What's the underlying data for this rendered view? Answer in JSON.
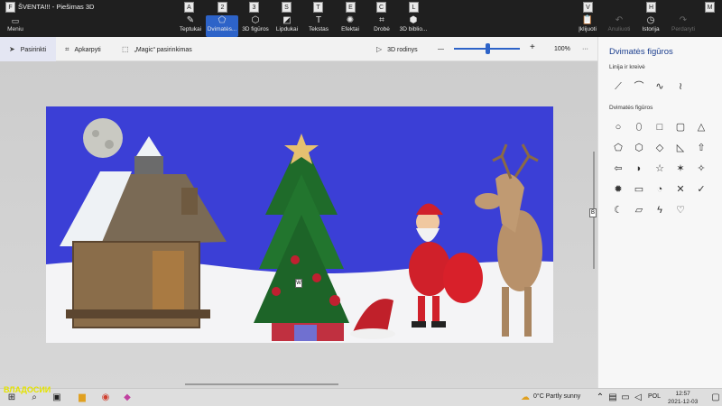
{
  "app_title": "ŠVENTA!!! - Piešimas 3D",
  "menu": {
    "label": "Meniu"
  },
  "toolbar": {
    "items": [
      {
        "label": "Teptukai",
        "key": "A",
        "icon": "brush-icon"
      },
      {
        "label": "Dvimatės...",
        "key": "2",
        "icon": "2d-shapes-icon"
      },
      {
        "label": "3D figūros",
        "key": "3",
        "icon": "3d-shapes-icon"
      },
      {
        "label": "Lipdukai",
        "key": "S",
        "icon": "sticker-icon"
      },
      {
        "label": "Tekstas",
        "key": "T",
        "icon": "text-icon"
      },
      {
        "label": "Efektai",
        "key": "E",
        "icon": "effects-icon"
      },
      {
        "label": "Drobė",
        "key": "C",
        "icon": "canvas-icon"
      },
      {
        "label": "3D biblio...",
        "key": "L",
        "icon": "3d-library-icon"
      }
    ],
    "right_items": [
      {
        "label": "Įklijuoti",
        "key": "V",
        "icon": "paste-icon"
      },
      {
        "label": "Anuliuoti",
        "icon": "undo-icon"
      },
      {
        "label": "Istorija",
        "key": "H",
        "icon": "history-icon"
      },
      {
        "label": "Perdaryti",
        "icon": "redo-icon"
      }
    ],
    "m_key": "M"
  },
  "subbar": {
    "select": "Pasirinkti",
    "crop": "Apkarpyti",
    "magic": "„Magic“ pasirinkimas",
    "view3d": "3D rodinys",
    "zoom": "100%",
    "minus": "—",
    "plus": "+",
    "more": "···",
    "zoom_level": 0.5
  },
  "panel": {
    "title": "Dvimatės figūros",
    "lines_label": "Linija ir kreivė",
    "shapes_label": "Dvimatės figūros",
    "lines": [
      "⟋",
      "⌒",
      "∿",
      "≀"
    ],
    "shapes": [
      "○",
      "⬯",
      "□",
      "▢",
      "△",
      "⬠",
      "⬡",
      "◇",
      "◺",
      "⇧",
      "⇦",
      "◗",
      "☆",
      "✶",
      "✧",
      "✹",
      "▭",
      "◔",
      "✕",
      "✓",
      "☾",
      "▱",
      "ϟ",
      "♡"
    ]
  },
  "canvas_handles": {
    "w": "W",
    "b": "B"
  },
  "taskbar": {
    "weather": "0°C  Partly sunny",
    "lang": "POL",
    "time": "12:57",
    "date": "2021-12-03"
  },
  "watermark": "ВЛАДОСИИ",
  "colors": {
    "canvas_bg": "#3b3fd6",
    "accent": "#2d63c8",
    "ribbon": "#1f1f1f"
  }
}
